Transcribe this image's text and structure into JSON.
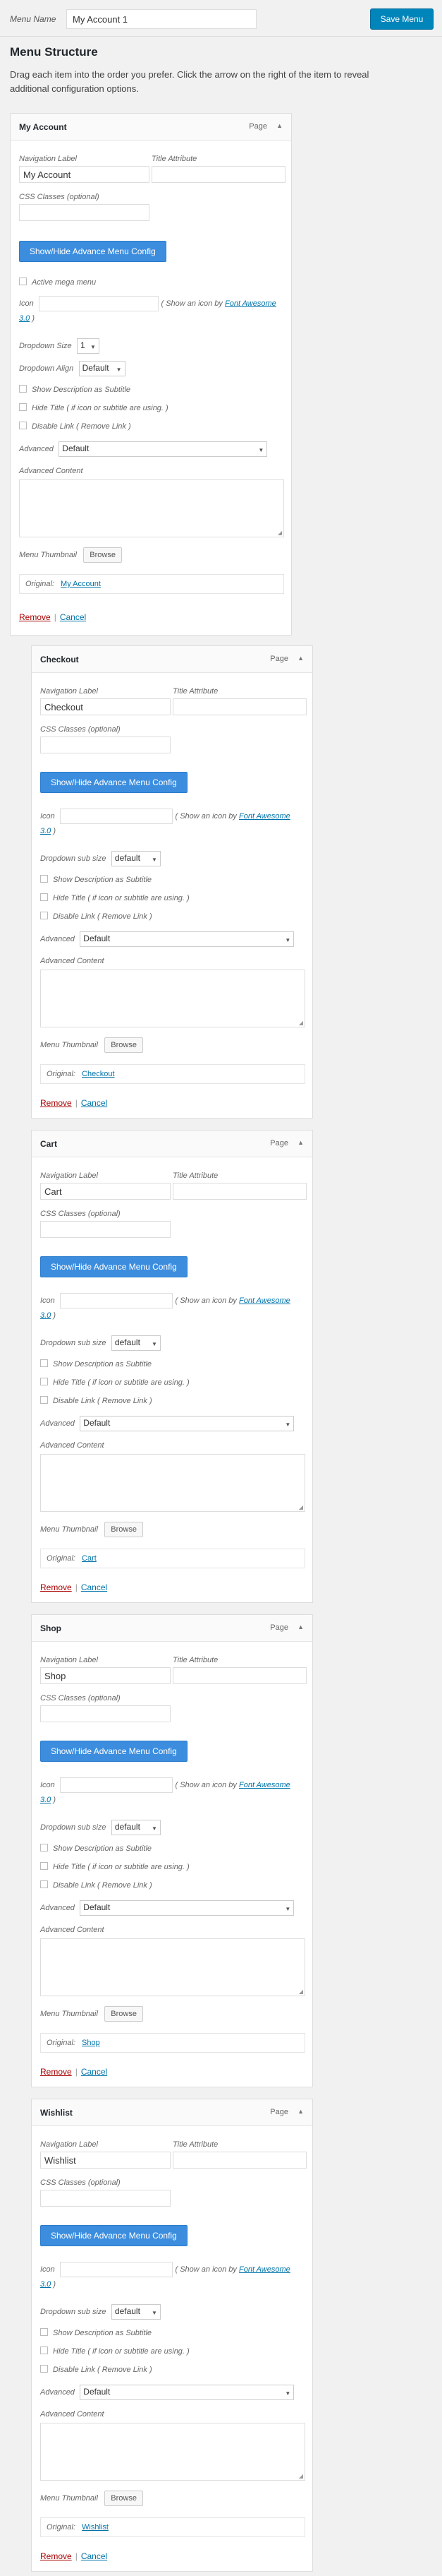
{
  "topbar": {
    "menu_name_label": "Menu Name",
    "menu_name_value": "My Account 1",
    "save_label": "Save Menu"
  },
  "structure": {
    "title": "Menu Structure",
    "description": "Drag each item into the order you prefer. Click the arrow on the right of the item to reveal additional configuration options."
  },
  "labels": {
    "type": "Page",
    "nav_label": "Navigation Label",
    "title_attr": "Title Attribute",
    "css_classes": "CSS Classes (optional)",
    "toggle_button": "Show/Hide Advance Menu Config",
    "mega_menu": "Active mega menu",
    "icon": "Icon",
    "icon_note_pre": "( Show an icon by ",
    "icon_note_link": "Font Awesome",
    "icon_note_version": "3.0",
    "icon_note_post": " )",
    "dropdown_size": "Dropdown Size",
    "dropdown_size_value": "1",
    "dropdown_align": "Dropdown Align",
    "dropdown_align_value": "Default",
    "dropdown_sub_size": "Dropdown sub size",
    "dropdown_sub_size_value": "default",
    "show_desc": "Show Description as Subtitle",
    "hide_title": "Hide Title ( if icon or subtitle are using. )",
    "disable_link": "Disable Link ( Remove Link )",
    "advanced": "Advanced",
    "advanced_value": "Default",
    "advanced_content": "Advanced Content",
    "thumbnail": "Menu Thumbnail",
    "browse": "Browse",
    "original": "Original:",
    "remove": "Remove",
    "cancel": "Cancel"
  },
  "items": [
    {
      "title": "My Account",
      "nav_value": "My Account",
      "original_link": "My Account"
    },
    {
      "title": "Checkout",
      "nav_value": "Checkout",
      "original_link": "Checkout"
    },
    {
      "title": "Cart",
      "nav_value": "Cart",
      "original_link": "Cart"
    },
    {
      "title": "Shop",
      "nav_value": "Shop",
      "original_link": "Shop"
    },
    {
      "title": "Wishlist",
      "nav_value": "Wishlist",
      "original_link": "Wishlist"
    }
  ]
}
